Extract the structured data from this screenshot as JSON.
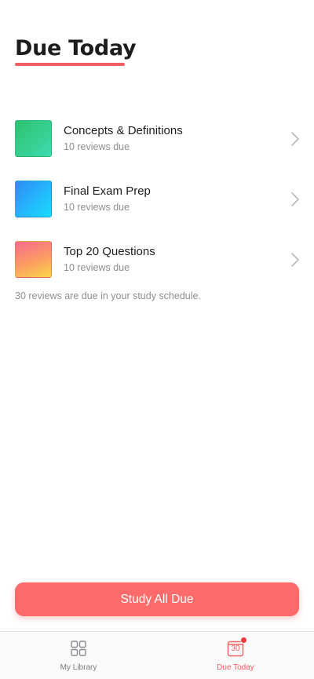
{
  "header": {
    "title": "Due Today"
  },
  "decks": [
    {
      "name": "Concepts & Definitions",
      "subtitle": "10 reviews due",
      "thumb": "green-gradient"
    },
    {
      "name": "Final Exam Prep",
      "subtitle": "10 reviews due",
      "thumb": "blue-gradient"
    },
    {
      "name": "Top 20 Questions",
      "subtitle": "10 reviews due",
      "thumb": "pink-orange-gradient"
    }
  ],
  "summary": "30 reviews are due in your study schedule.",
  "actions": {
    "study_all_label": "Study All Due"
  },
  "tabbar": {
    "tabs": [
      {
        "label": "My Library",
        "icon": "grid-icon",
        "active": false
      },
      {
        "label": "Due Today",
        "icon": "calendar-icon",
        "active": true,
        "calendar_number": "30",
        "has_badge": true
      }
    ]
  },
  "colors": {
    "accent": "#ef5f62",
    "button": "#ff6b6b",
    "text_primary": "#1d1d1f",
    "text_secondary": "#8e8e93"
  }
}
